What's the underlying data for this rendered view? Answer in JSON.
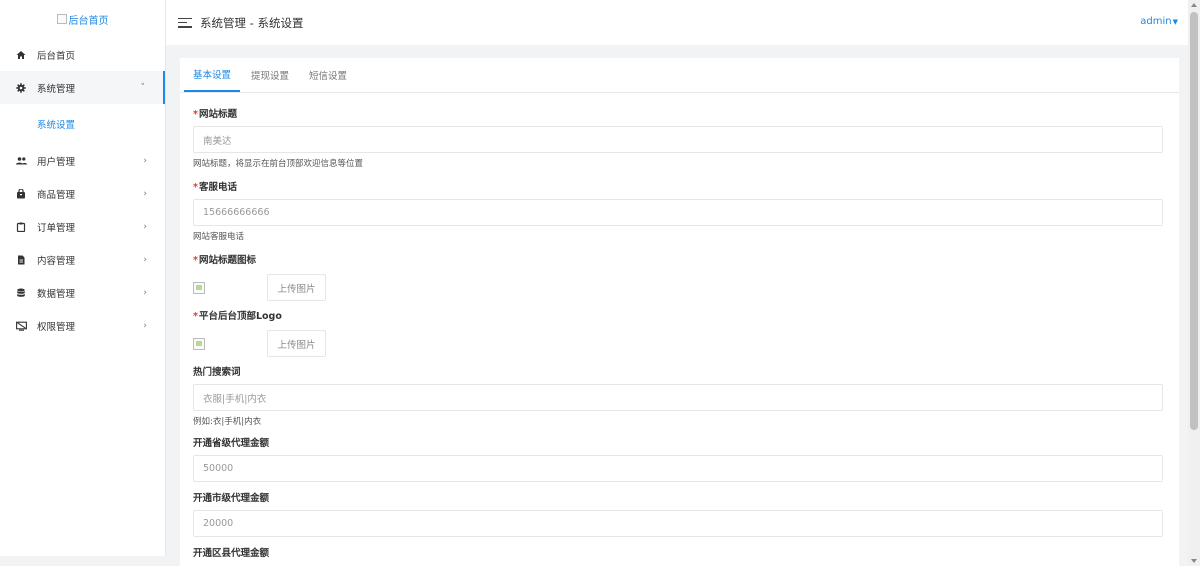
{
  "sidebar": {
    "logo_alt": "后台首页",
    "items": [
      {
        "label": "后台首页",
        "icon": "home-icon"
      },
      {
        "label": "系统管理",
        "icon": "gear-icon",
        "open": true
      },
      {
        "label": "用户管理",
        "icon": "users-icon"
      },
      {
        "label": "商品管理",
        "icon": "bag-icon"
      },
      {
        "label": "订单管理",
        "icon": "clipboard-icon"
      },
      {
        "label": "内容管理",
        "icon": "document-icon"
      },
      {
        "label": "数据管理",
        "icon": "database-icon"
      },
      {
        "label": "权限管理",
        "icon": "screen-icon"
      }
    ],
    "submenu": {
      "label": "系统设置"
    }
  },
  "header": {
    "title": "系统管理 - 系统设置",
    "user": "admin"
  },
  "tabs": [
    {
      "label": "基本设置",
      "active": true
    },
    {
      "label": "提现设置"
    },
    {
      "label": "短信设置"
    }
  ],
  "form": {
    "site_title": {
      "label": "网站标题",
      "required": true,
      "value": "南美达",
      "hint": "网站标题，将显示在前台顶部欢迎信息等位置"
    },
    "service_phone": {
      "label": "客服电话",
      "required": true,
      "value": "15666666666",
      "hint": "网站客服电话"
    },
    "site_icon": {
      "label": "网站标题图标",
      "required": true,
      "button": "上传图片"
    },
    "admin_logo": {
      "label": "平台后台顶部Logo",
      "required": true,
      "button": "上传图片"
    },
    "hot_search": {
      "label": "热门搜索词",
      "value": "衣服|手机|内衣",
      "hint": "例如:衣|手机|内衣"
    },
    "province_agent": {
      "label": "开通省级代理金额",
      "value": "50000"
    },
    "city_agent": {
      "label": "开通市级代理金额",
      "value": "20000"
    },
    "district_agent": {
      "label": "开通区县代理金额"
    }
  },
  "colors": {
    "accent": "#1e88e5",
    "required": "#e53935"
  }
}
